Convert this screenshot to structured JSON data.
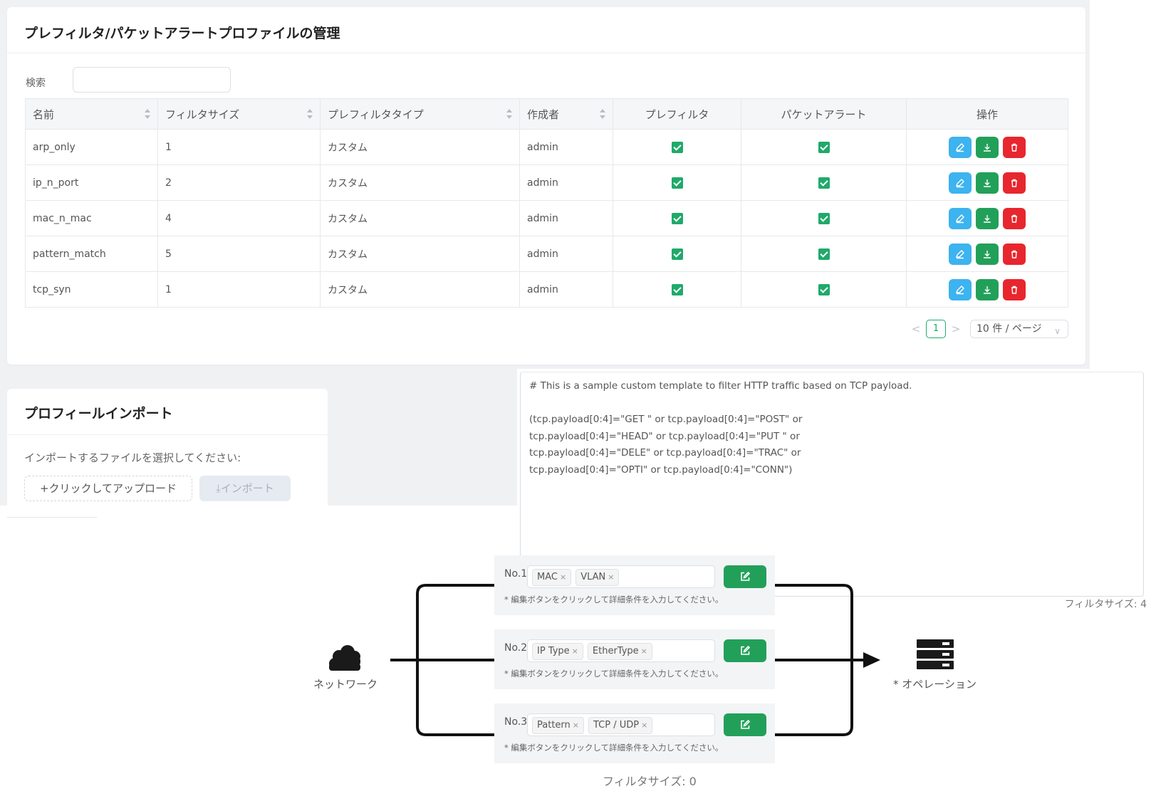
{
  "management": {
    "title": "プレフィルタ/パケットアラートプロファイルの管理",
    "search": {
      "label": "検索",
      "value": "",
      "placeholder": ""
    },
    "columns": [
      "名前",
      "フィルタサイズ",
      "プレフィルタタイプ",
      "作成者",
      "プレフィルタ",
      "パケットアラート",
      "操作"
    ],
    "rows": [
      {
        "name": "arp_only",
        "size": "1",
        "type": "カスタム",
        "author": "admin",
        "prefilter": true,
        "packet_alert": true
      },
      {
        "name": "ip_n_port",
        "size": "2",
        "type": "カスタム",
        "author": "admin",
        "prefilter": true,
        "packet_alert": true
      },
      {
        "name": "mac_n_mac",
        "size": "4",
        "type": "カスタム",
        "author": "admin",
        "prefilter": true,
        "packet_alert": true
      },
      {
        "name": "pattern_match",
        "size": "5",
        "type": "カスタム",
        "author": "admin",
        "prefilter": true,
        "packet_alert": true
      },
      {
        "name": "tcp_syn",
        "size": "1",
        "type": "カスタム",
        "author": "admin",
        "prefilter": true,
        "packet_alert": true
      }
    ],
    "actions": {
      "edit_icon": "pencil-icon",
      "download_icon": "download-icon",
      "delete_icon": "trash-icon"
    },
    "pagination": {
      "prev": "<",
      "current": "1",
      "next": ">",
      "page_size": "10 件 / ページ"
    }
  },
  "import": {
    "title": "プロフィールインポート",
    "label": "インポートするファイルを選択してください:",
    "upload_button": "+クリックしてアップロード",
    "import_button": "⤓インポート"
  },
  "editor": {
    "text": "# This is a sample custom template to filter HTTP traffic based on TCP payload.\n\n(tcp.payload[0:4]=\"GET \" or tcp.payload[0:4]=\"POST\" or\ntcp.payload[0:4]=\"HEAD\" or tcp.payload[0:4]=\"PUT \" or\ntcp.payload[0:4]=\"DELE\" or tcp.payload[0:4]=\"TRAC\" or\ntcp.payload[0:4]=\"OPTI\" or tcp.payload[0:4]=\"CONN\")",
    "filter_size": "フィルタサイズ: 4"
  },
  "diagram": {
    "network_label": "ネットワーク",
    "operation_label": "* オペレーション",
    "rules": [
      {
        "no": "No.1",
        "tags": [
          "MAC",
          "VLAN"
        ],
        "hint": "* 編集ボタンをクリックして詳細条件を入力してください。"
      },
      {
        "no": "No.2",
        "tags": [
          "IP Type",
          "EtherType"
        ],
        "hint": "* 編集ボタンをクリックして詳細条件を入力してください。"
      },
      {
        "no": "No.3",
        "tags": [
          "Pattern",
          "TCP / UDP"
        ],
        "hint": "* 編集ボタンをクリックして詳細条件を入力してください。"
      }
    ],
    "filter_size": "フィルタサイズ: 0"
  },
  "colors": {
    "accent_green": "#22a05a",
    "edit_blue": "#3db3ef",
    "delete_red": "#e8262e",
    "check_green": "#1faa6a"
  }
}
